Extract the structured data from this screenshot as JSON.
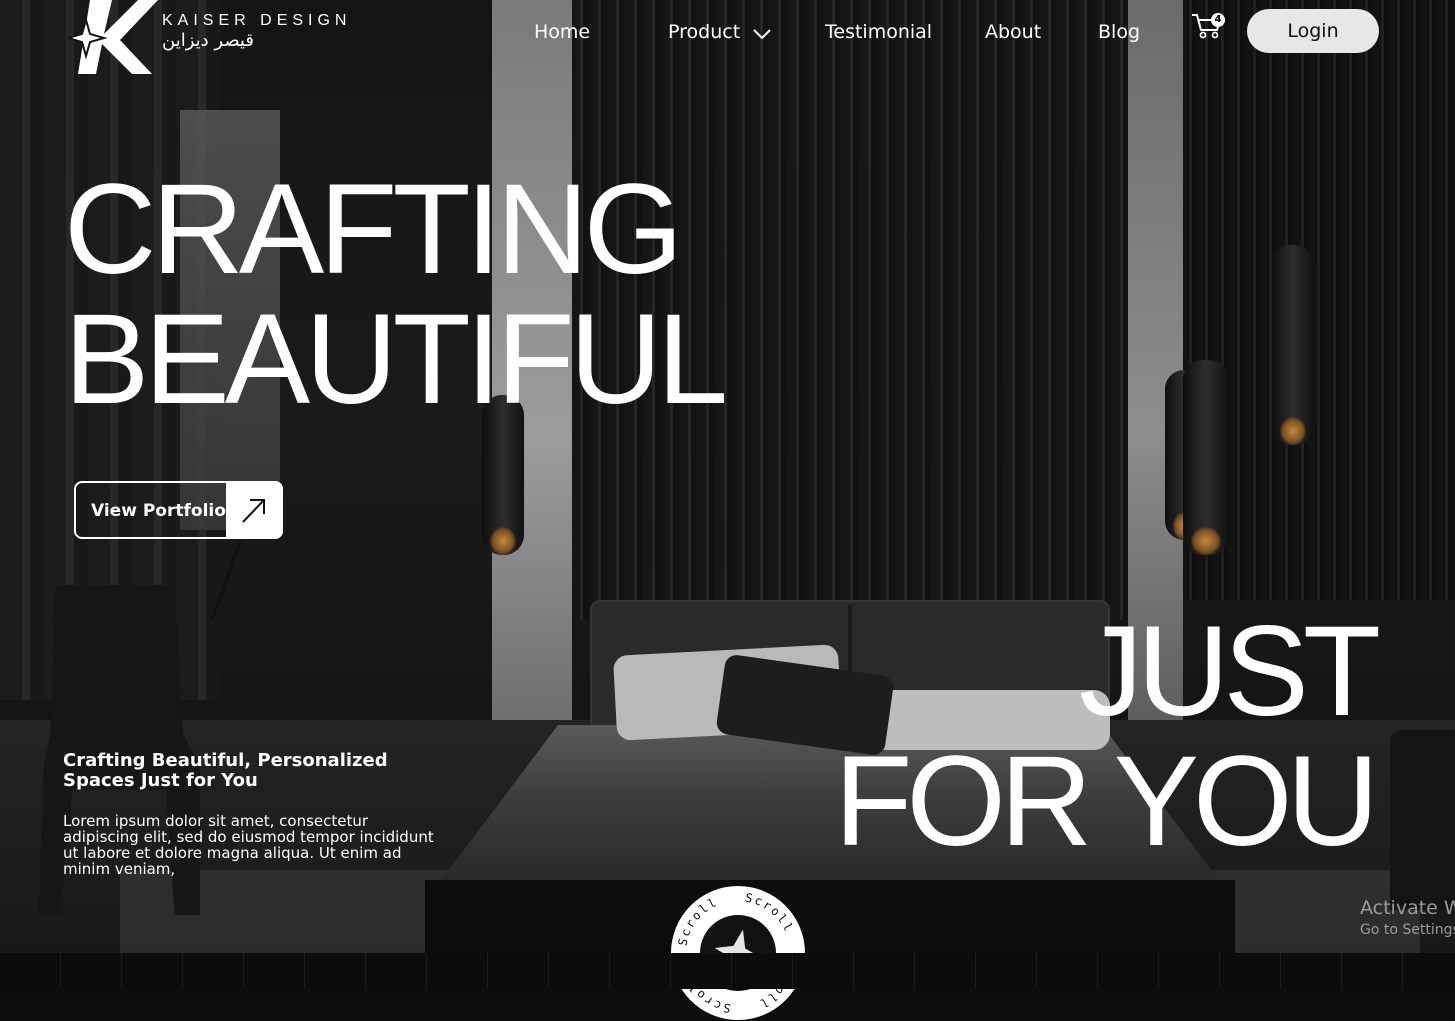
{
  "brand": {
    "name": "KAISER DESIGN",
    "name_arabic": "قيصر ديزاين"
  },
  "nav": {
    "items": [
      {
        "label": "Home"
      },
      {
        "label": "Product"
      },
      {
        "label": "Testimonial"
      },
      {
        "label": "About"
      },
      {
        "label": "Blog"
      }
    ],
    "cart_count": "4",
    "login_label": "Login"
  },
  "hero": {
    "headline_line1": "CRAFTING",
    "headline_line2": "BEAUTIFUL",
    "headline2_line1": "JUST",
    "headline2_line2": "FOR YOU",
    "cta_label": "View Portfolio",
    "subtitle": "Crafting Beautiful, Personalized Spaces Just for You",
    "body": "Lorem ipsum dolor sit amet, consectetur adipiscing elit, sed do eiusmod tempor incididunt ut labore et dolore magna aliqua. Ut enim ad minim veniam,",
    "scroll_label": "Scroll"
  },
  "watermark": {
    "line1": "Activate W",
    "line2": "Go to Settings"
  },
  "icons": {
    "logo": "k-star-logo-icon",
    "chevron": "chevron-down-icon",
    "cart": "cart-icon",
    "arrow": "arrow-up-right-icon",
    "scroll_star": "star-icon"
  },
  "colors": {
    "background": "#0d0d0d",
    "text": "#ffffff",
    "login_bg": "#e7e7e7"
  }
}
